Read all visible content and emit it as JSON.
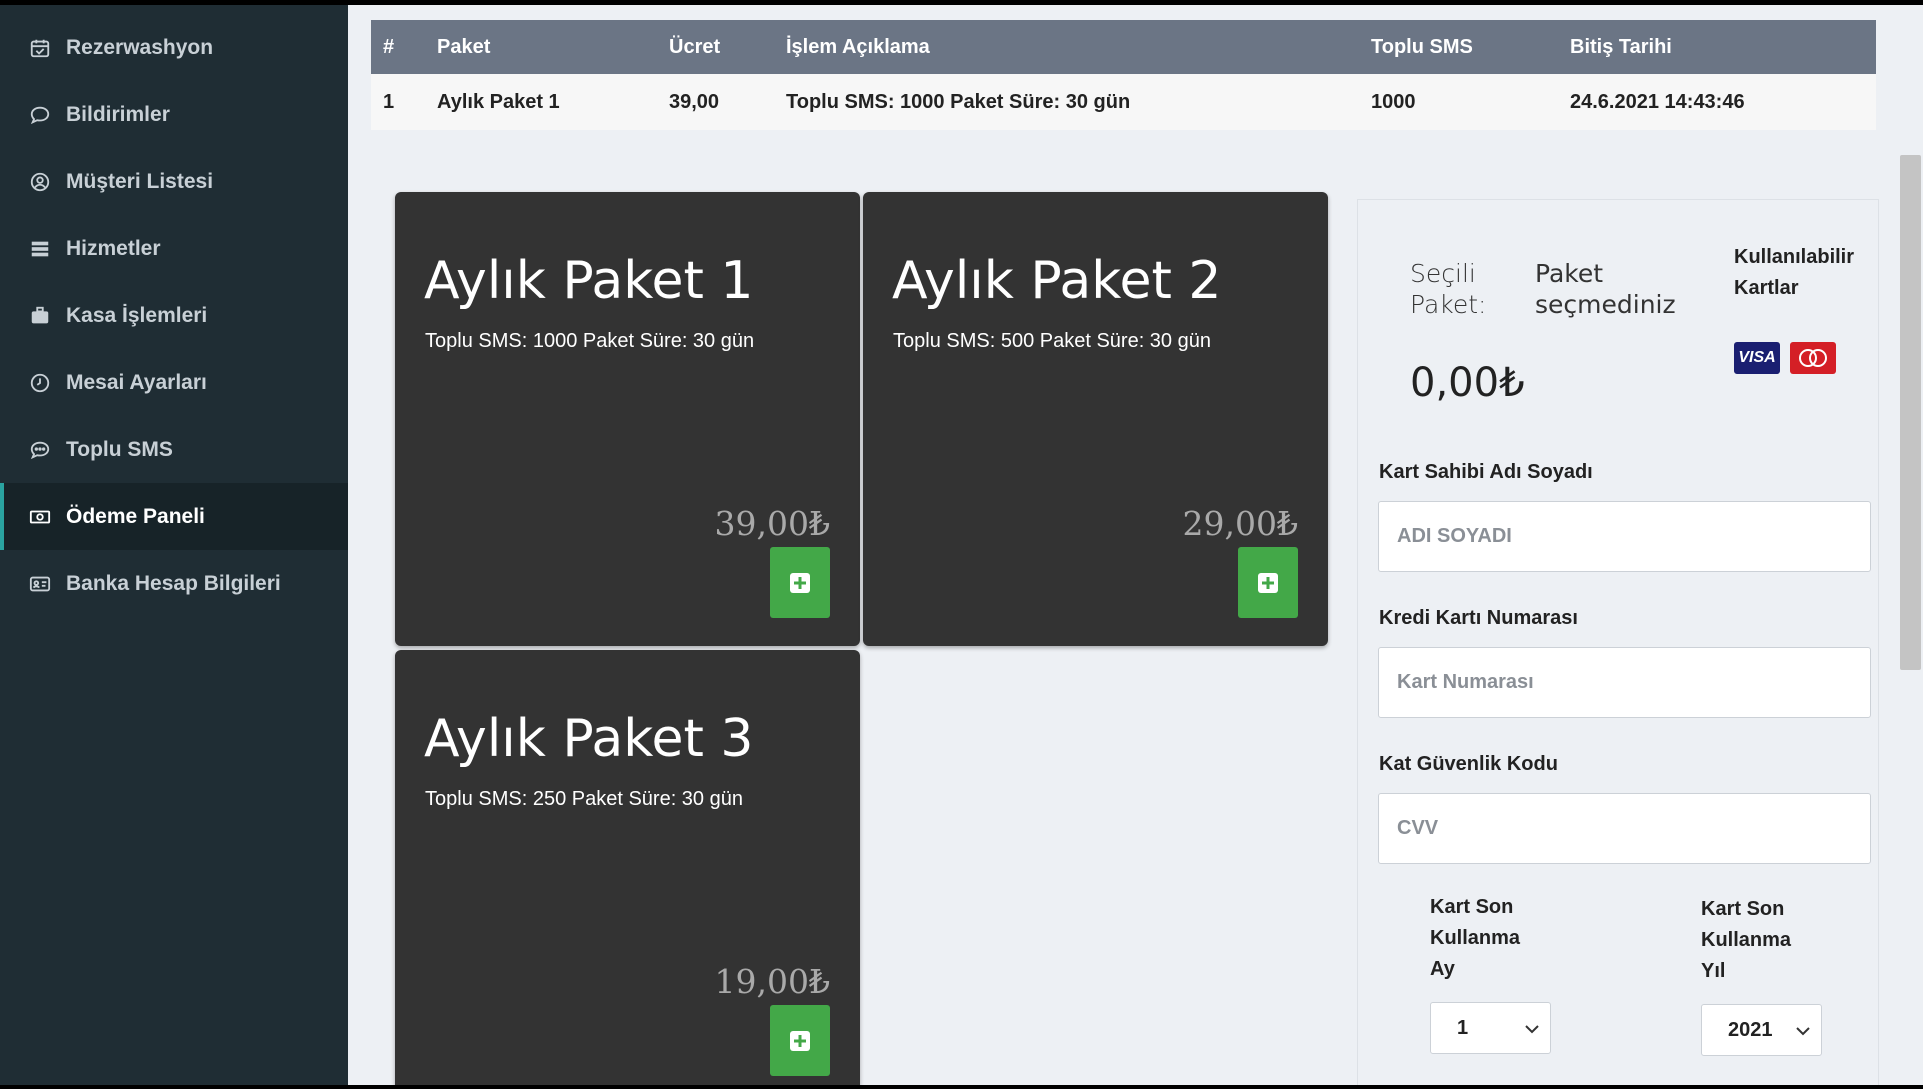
{
  "sidebar": {
    "items": [
      {
        "label": "Rezerwashyon",
        "icon": "calendar-check-icon"
      },
      {
        "label": "Bildirimler",
        "icon": "comment-icon"
      },
      {
        "label": "Müşteri Listesi",
        "icon": "user-circle-icon"
      },
      {
        "label": "Hizmetler",
        "icon": "list-icon"
      },
      {
        "label": "Kasa İşlemleri",
        "icon": "briefcase-icon"
      },
      {
        "label": "Mesai Ayarları",
        "icon": "clock-icon"
      },
      {
        "label": "Toplu SMS",
        "icon": "comment-dots-icon"
      },
      {
        "label": "Ödeme Paneli",
        "icon": "money-bill-icon",
        "active": true
      },
      {
        "label": "Banka Hesap Bilgileri",
        "icon": "id-card-icon"
      }
    ]
  },
  "table": {
    "headers": [
      "#",
      "Paket",
      "Ücret",
      "İşlem Açıklama",
      "Toplu SMS",
      "Bitiş Tarihi"
    ],
    "rows": [
      [
        "1",
        "Aylık Paket 1",
        "39,00",
        "Toplu SMS: 1000 Paket Süre: 30 gün",
        "1000",
        "24.6.2021 14:43:46"
      ]
    ]
  },
  "packages": [
    {
      "title": "Aylık Paket 1",
      "desc": "Toplu SMS: 1000 Paket Süre: 30 gün",
      "price": "39,00₺"
    },
    {
      "title": "Aylık Paket 2",
      "desc": "Toplu SMS: 500 Paket Süre: 30 gün",
      "price": "29,00₺"
    },
    {
      "title": "Aylık Paket 3",
      "desc": "Toplu SMS: 250 Paket Süre: 30 gün",
      "price": "19,00₺"
    }
  ],
  "payment": {
    "selected_label": "Seçili Paket:",
    "selected_value": "Paket seçmediniz",
    "cards_title": "Kullanılabilir Kartlar",
    "visa_text": "VISA",
    "total": "0,00₺",
    "name_label": "Kart Sahibi Adı Soyadı",
    "name_placeholder": "ADI SOYADI",
    "card_label": "Kredi Kartı Numarası",
    "card_placeholder": "Kart Numarası",
    "cvv_label": "Kat Güvenlik Kodu",
    "cvv_placeholder": "CVV",
    "month_label": "Kart Son Kullanma Ay",
    "month_value": "1",
    "year_label": "Kart Son Kullanma Yıl",
    "year_value": "2021"
  },
  "colors": {
    "sidebar_bg": "#1f2d34",
    "active_accent": "#2aa3a0",
    "table_header": "#6b7585",
    "card_bg": "#333333",
    "add_button": "#43a848"
  }
}
